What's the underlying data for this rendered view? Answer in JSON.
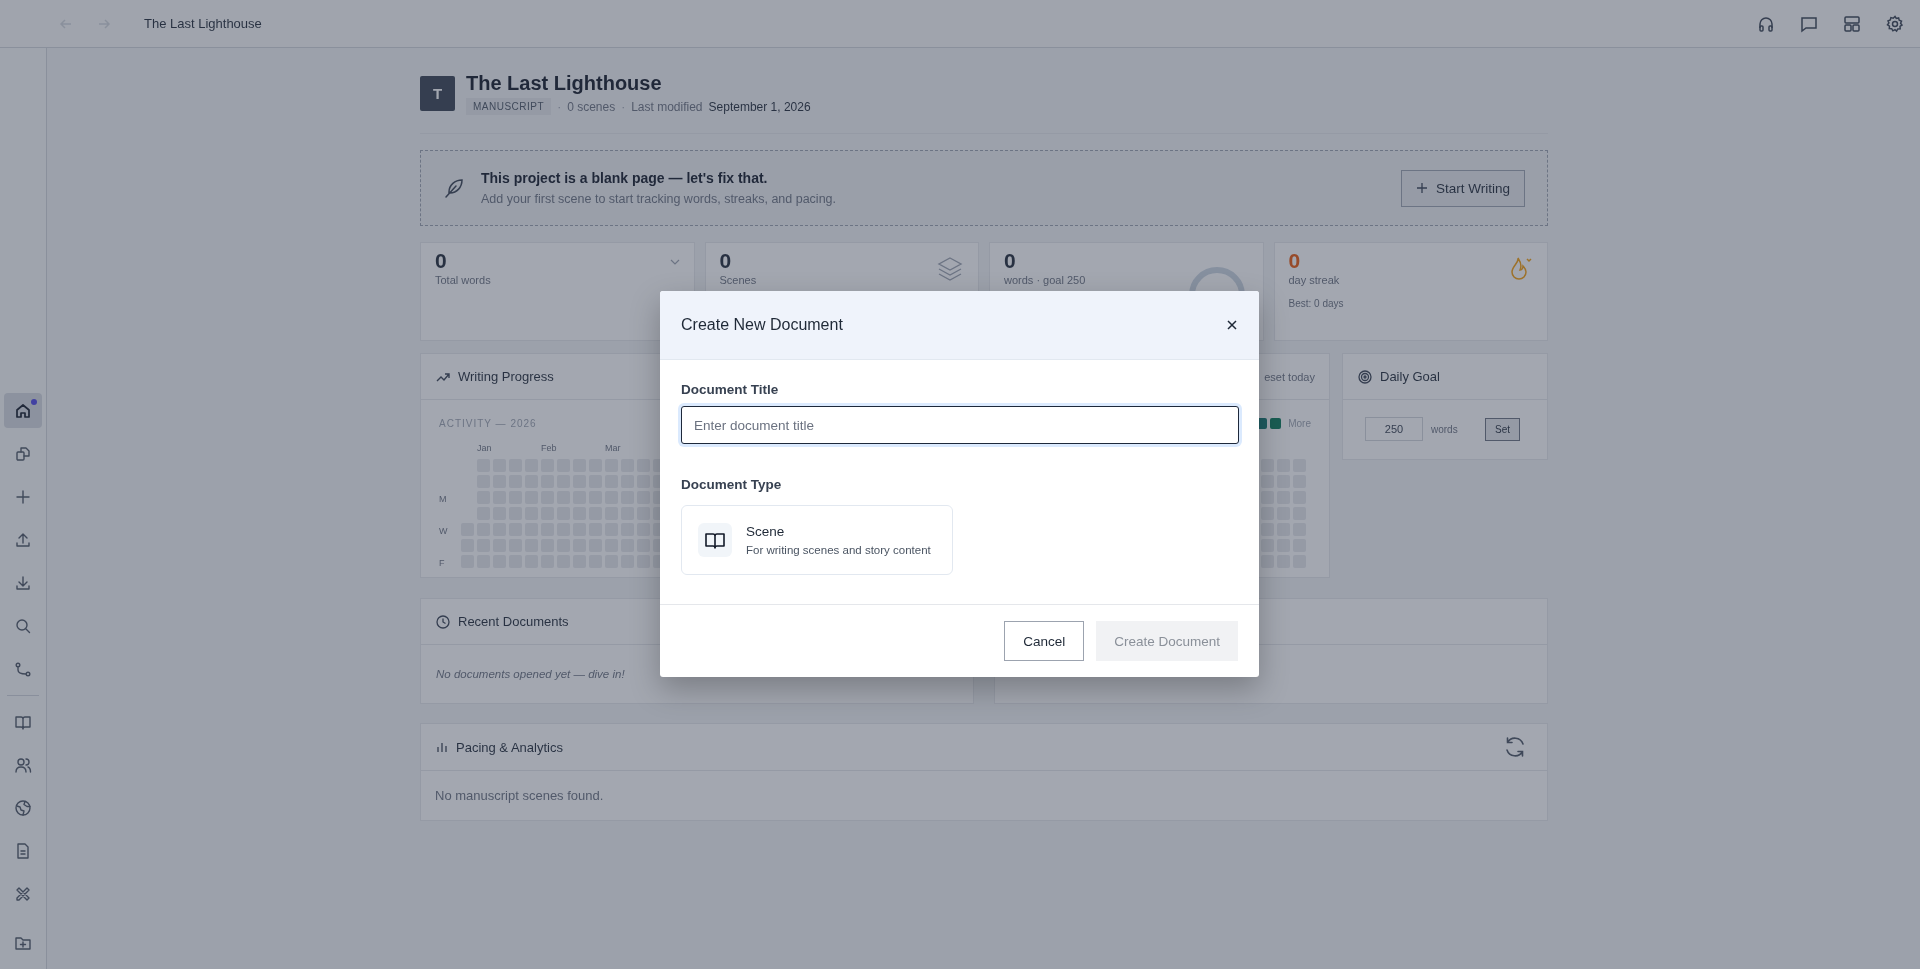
{
  "topbar": {
    "title": "The Last Lighthouse",
    "back_disabled": true,
    "forward_disabled": true
  },
  "sidebar": {
    "items": [
      {
        "selected": true,
        "notification": true
      },
      {
        "selected": false,
        "notification": false
      },
      {
        "selected": false,
        "notification": false
      },
      {
        "selected": false,
        "notification": false
      },
      {
        "selected": false,
        "notification": false
      },
      {
        "selected": false,
        "notification": false
      },
      {
        "selected": false,
        "notification": false
      },
      {
        "selected": false,
        "notification": false
      },
      {
        "selected": false,
        "notification": false
      },
      {
        "selected": false,
        "notification": false
      },
      {
        "selected": false,
        "notification": false
      },
      {
        "selected": false,
        "notification": false
      },
      {
        "selected": false,
        "notification": false
      }
    ]
  },
  "project": {
    "avatar": "T",
    "title": "The Last Lighthouse",
    "badge": "MANUSCRIPT",
    "separators": [
      "·",
      "·"
    ],
    "scenes": "0 scenes",
    "modified_label": "Last modified",
    "modified_date": "September 1, 2026"
  },
  "banner": {
    "title": "This project is a blank page — let's fix that.",
    "subtitle": "Add your first scene to start tracking words, streaks, and pacing.",
    "button": "Start Writing"
  },
  "stats": [
    {
      "kind": "total",
      "value": "0",
      "label": "Total words"
    },
    {
      "kind": "scenes",
      "value": "0",
      "label": "Scenes"
    },
    {
      "kind": "goal",
      "value": "0",
      "label": "words · goal 250",
      "level": 0
    },
    {
      "kind": "streak",
      "value": "0",
      "label": "day streak",
      "note": "Best: 0 days"
    }
  ],
  "writing_progress": {
    "title": "Writing Progress",
    "activity_label": "ACTIVITY — 2026",
    "months": [
      "Jan",
      "Feb",
      "Mar"
    ],
    "days": [
      "M",
      "W",
      "F"
    ],
    "reset": "eset today",
    "legend_more": "More"
  },
  "daily_goal": {
    "title": "Daily Goal",
    "value": "250",
    "unit": "words",
    "button": "Set"
  },
  "recent_documents": {
    "title": "Recent Documents",
    "empty": "No documents opened yet — dive in!"
  },
  "pacing": {
    "title": "Pacing & Analytics",
    "empty": "No manuscript scenes found."
  },
  "modal": {
    "title": "Create New Document",
    "title_label": "Document Title",
    "title_placeholder": "Enter document title",
    "type_label": "Document Type",
    "types": [
      {
        "name": "Scene",
        "description": "For writing scenes and story content",
        "selected": false
      }
    ],
    "cancel": "Cancel",
    "create": "Create Document",
    "create_disabled": true
  }
}
